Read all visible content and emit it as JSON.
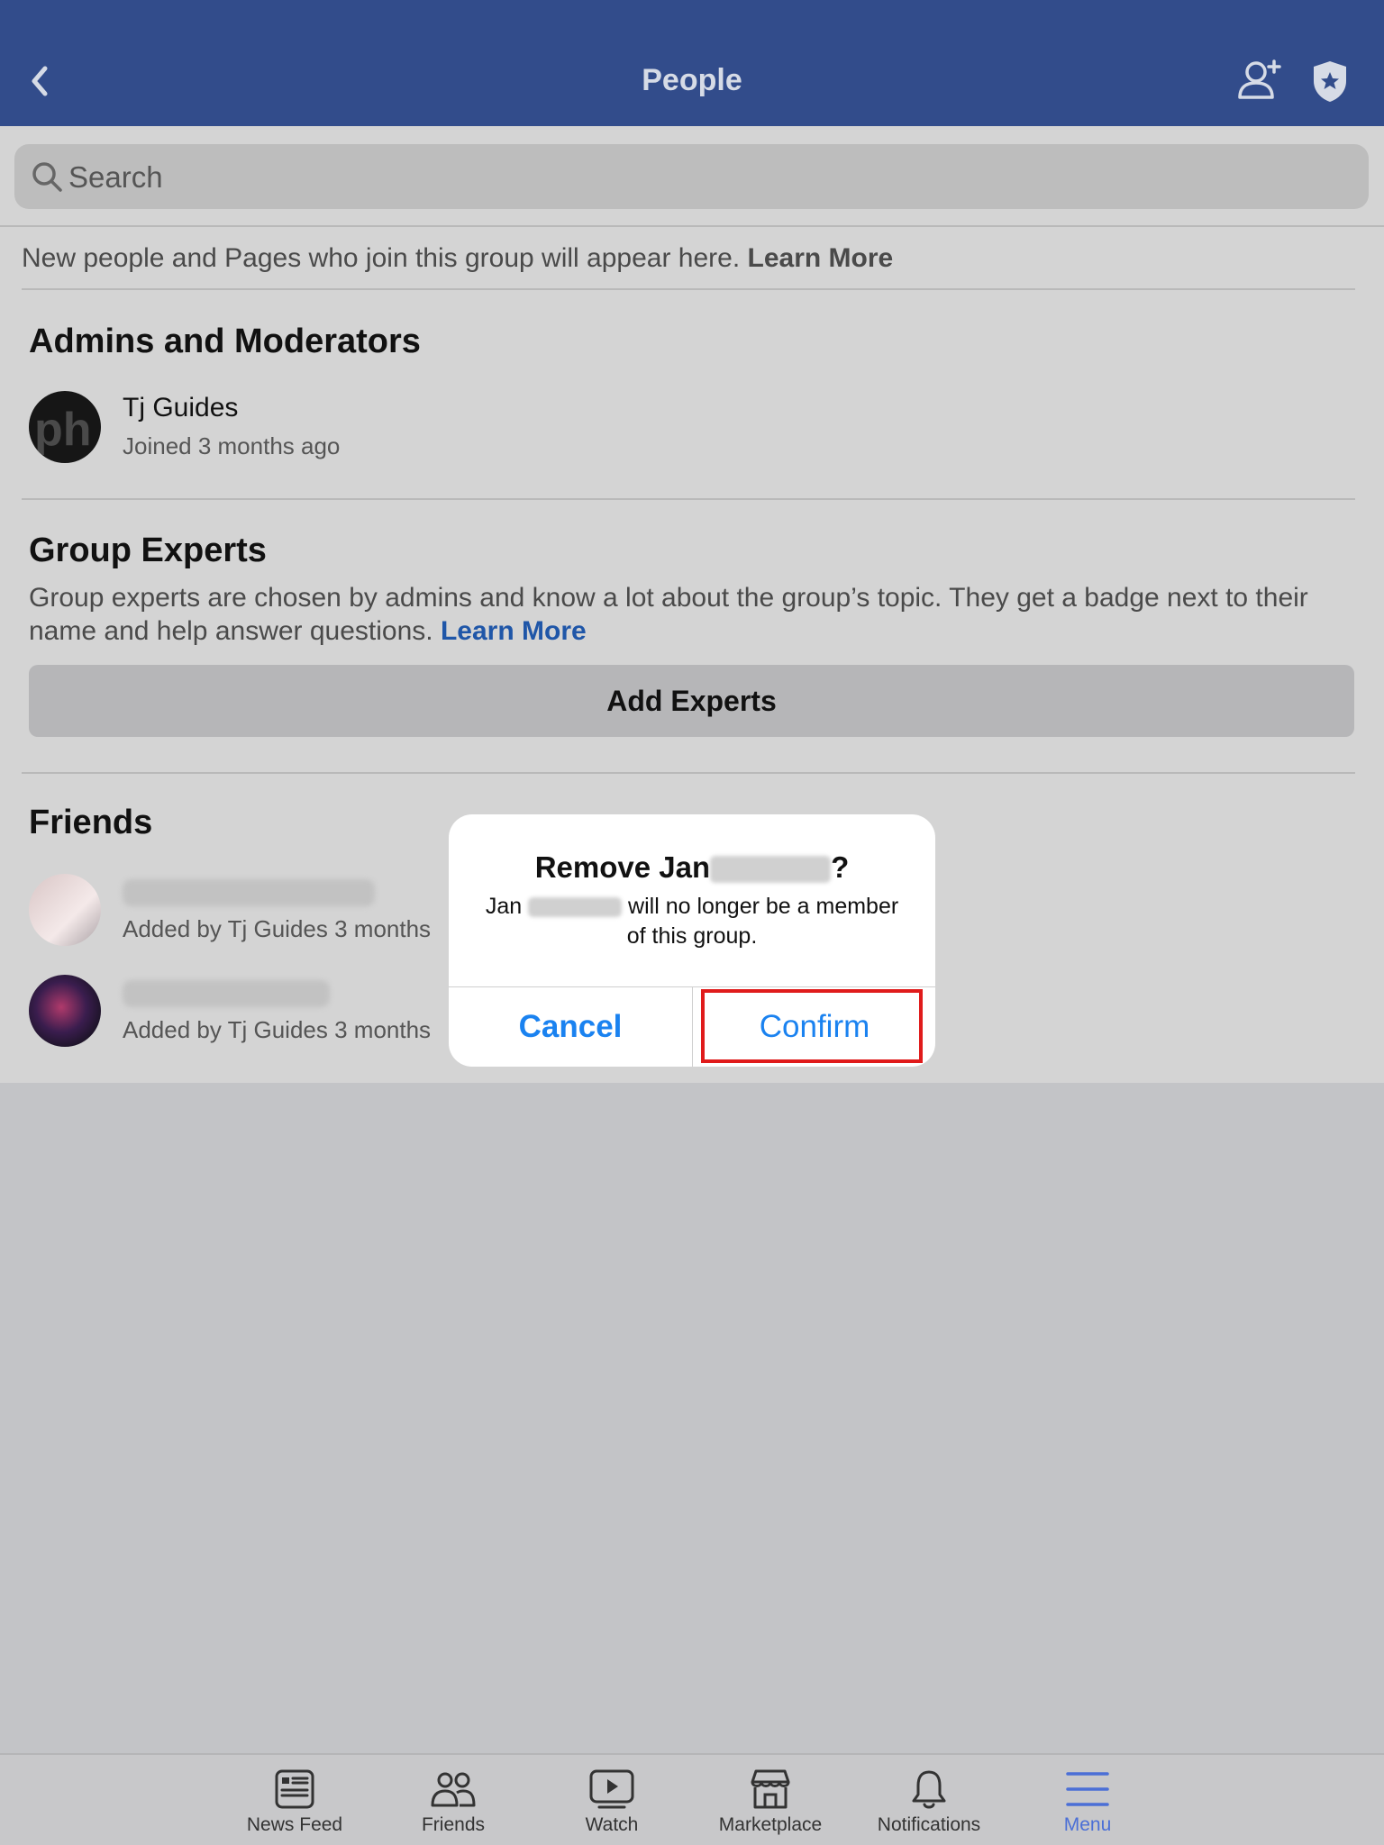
{
  "header": {
    "title": "People"
  },
  "search": {
    "placeholder": "Search"
  },
  "info": {
    "text": "New people and Pages who join this group will appear here.",
    "link": "Learn More"
  },
  "admins": {
    "title": "Admins and Moderators",
    "members": [
      {
        "name": "Tj Guides",
        "subtitle": "Joined 3 months ago"
      }
    ]
  },
  "experts": {
    "title": "Group Experts",
    "description": "Group experts are chosen by admins and know a lot about the group’s topic. They get a badge next to their name and help answer questions.",
    "link": "Learn More",
    "button": "Add Experts"
  },
  "friends": {
    "title": "Friends",
    "members": [
      {
        "subtitle": "Added by Tj Guides 3 months"
      },
      {
        "subtitle": "Added by Tj Guides 3 months"
      }
    ]
  },
  "dialog": {
    "title_prefix": "Remove Jan",
    "title_suffix": "?",
    "msg_prefix": "Jan",
    "msg_suffix": "will no longer be a member of this group.",
    "cancel": "Cancel",
    "confirm": "Confirm"
  },
  "tabs": [
    {
      "label": "News Feed",
      "icon": "news-feed-icon"
    },
    {
      "label": "Friends",
      "icon": "friends-icon"
    },
    {
      "label": "Watch",
      "icon": "watch-icon"
    },
    {
      "label": "Marketplace",
      "icon": "marketplace-icon"
    },
    {
      "label": "Notifications",
      "icon": "bell-icon"
    },
    {
      "label": "Menu",
      "icon": "menu-icon",
      "active": true
    }
  ],
  "colors": {
    "header": "#324c8b",
    "link": "#1f56a8",
    "ios_blue": "#1a82f0",
    "highlight": "#e01b1b",
    "active_tab": "#4b6fd6"
  }
}
